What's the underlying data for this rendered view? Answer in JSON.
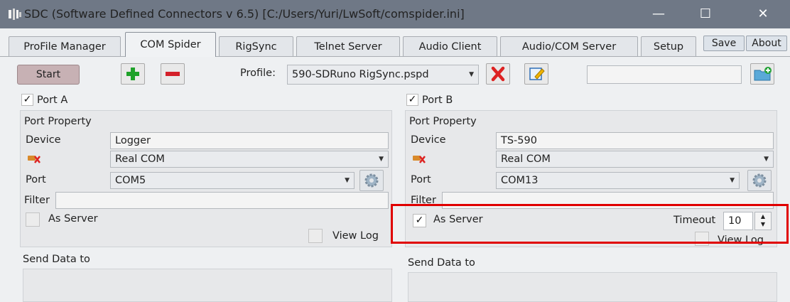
{
  "window": {
    "title": "SDC (Software Defined Connectors v 6.5) [C:/Users/Yuri/LwSoft/comspider.ini]",
    "minimize": "—",
    "maximize": "☐",
    "close": "✕"
  },
  "tabs": [
    "ProFile Manager",
    "COM Spider",
    "RigSync",
    "Telnet Server",
    "Audio Client",
    "Audio/COM Server",
    "Setup"
  ],
  "top_buttons": {
    "save": "Save",
    "about": "About"
  },
  "toolbar": {
    "start": "Start",
    "profile_label": "Profile:",
    "profile_value": "590-SDRuno RigSync.pspd",
    "path_value": ""
  },
  "port_a": {
    "label": "Port A",
    "checked": "✓",
    "section": "Port Property",
    "device_label": "Device",
    "device_value": "Logger",
    "type_value": "Real COM",
    "port_label": "Port",
    "port_value": "COM5",
    "filter_label": "Filter",
    "filter_value": "",
    "as_server": "As Server",
    "view_log": "View Log",
    "send_data": "Send Data to"
  },
  "port_b": {
    "label": "Port B",
    "checked": "✓",
    "section": "Port Property",
    "device_label": "Device",
    "device_value": "TS-590",
    "type_value": "Real COM",
    "port_label": "Port",
    "port_value": "COM13",
    "filter_label": "Filter",
    "filter_value": "",
    "as_server": "As Server",
    "as_server_checked": "✓",
    "timeout_label": "Timeout",
    "timeout_value": "10",
    "view_log": "View Log",
    "send_data": "Send Data to"
  },
  "colors": {
    "titlebar": "#6f7886",
    "highlight": "#e00000",
    "start_button": "#c7b1b4",
    "plus": "#1fa22a",
    "minus": "#d4202a"
  }
}
